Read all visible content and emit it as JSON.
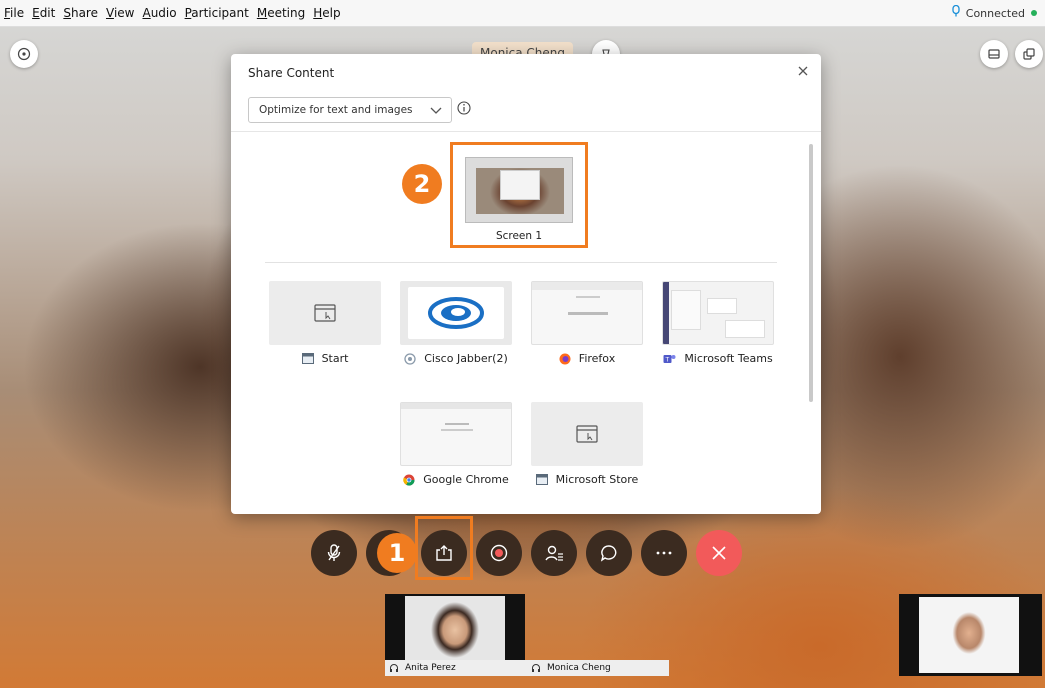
{
  "menubar": {
    "items": [
      "File",
      "Edit",
      "Share",
      "View",
      "Audio",
      "Participant",
      "Meeting",
      "Help"
    ],
    "status": "Connected",
    "status_icon": "headset-icon",
    "status_color": "#25b05a"
  },
  "video": {
    "speaker_name": "Monica Cheng"
  },
  "dialog": {
    "title": "Share Content",
    "optimize_value": "Optimize for text and images",
    "screen_label": "Screen 1",
    "apps": [
      {
        "label": "Start",
        "icon": "window-icon"
      },
      {
        "label": "Cisco Jabber(2)",
        "icon": "jabber-icon"
      },
      {
        "label": "Firefox",
        "icon": "firefox-icon"
      },
      {
        "label": "Microsoft Teams",
        "icon": "teams-icon"
      },
      {
        "label": "Google Chrome",
        "icon": "chrome-icon"
      },
      {
        "label": "Microsoft Store",
        "icon": "window-icon"
      }
    ]
  },
  "annotations": {
    "step1": "1",
    "step2": "2",
    "highlight_color": "#f07c20"
  },
  "controls": {
    "items": [
      "mute-icon",
      "video-icon",
      "share-icon",
      "record-icon",
      "participants-icon",
      "chat-icon",
      "more-icon",
      "leave-icon"
    ],
    "leave_color": "#f25a5a"
  },
  "participants": [
    {
      "name": "Anita Perez"
    },
    {
      "name": "Monica Cheng"
    }
  ]
}
